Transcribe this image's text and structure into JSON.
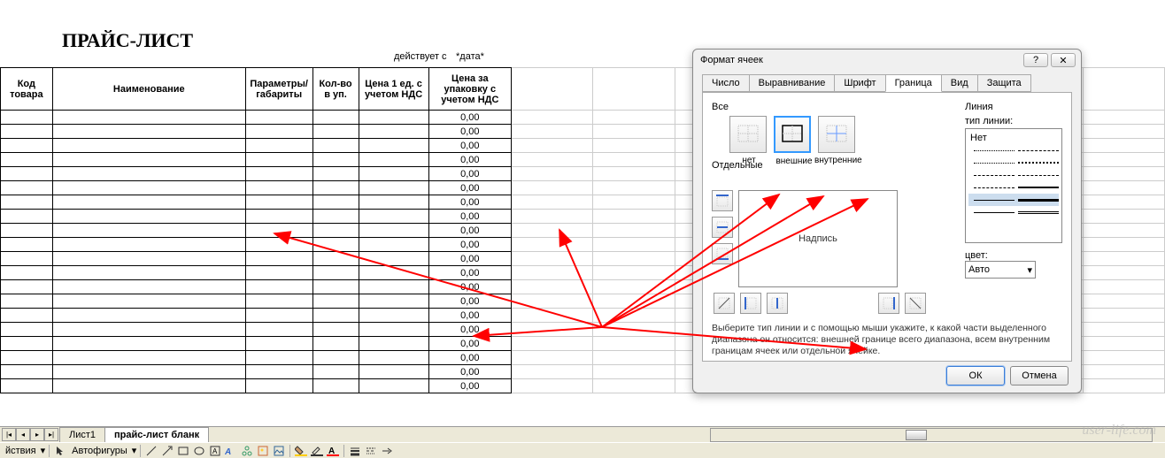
{
  "sheet": {
    "title": "ПРАЙС-ЛИСТ",
    "effective_label": "действует с",
    "effective_value": "*дата*",
    "headers": {
      "code": "Код товара",
      "name": "Наименование",
      "params": "Параметры/ габариты",
      "qty": "Кол-во в уп.",
      "price": "Цена 1 ед. с учетом НДС",
      "pack_price": "Цена за упаковку с учетом НДС"
    },
    "default_value": "0,00",
    "row_count": 20
  },
  "tabs": {
    "nav": {
      "first": "|◂",
      "prev": "◂",
      "next": "▸",
      "last": "▸|"
    },
    "tab1": "Лист1",
    "tab2": "прайс-лист бланк"
  },
  "toolbar": {
    "actions": "йствия",
    "autoshapes": "Автофигуры"
  },
  "dialog": {
    "title": "Формат ячеек",
    "help": "?",
    "close": "✕",
    "tabs": {
      "number": "Число",
      "align": "Выравнивание",
      "font": "Шрифт",
      "border": "Граница",
      "fill": "Вид",
      "protect": "Защита"
    },
    "all_label": "Все",
    "presets": {
      "none": "нет",
      "outline": "внешние",
      "inside": "внутренние"
    },
    "individual_label": "Отдельные",
    "preview_text": "Надпись",
    "line_label": "Линия",
    "style_label": "тип линии:",
    "style_none": "Нет",
    "color_label": "цвет:",
    "color_value": "Авто",
    "hint": "Выберите тип линии и с помощью мыши укажите, к какой части выделенного диапазона он относится: внешней границе всего диапазона, всем внутренним границам ячеек или отдельной ячейке.",
    "ok": "ОК",
    "cancel": "Отмена"
  },
  "watermark": "user-life.com"
}
